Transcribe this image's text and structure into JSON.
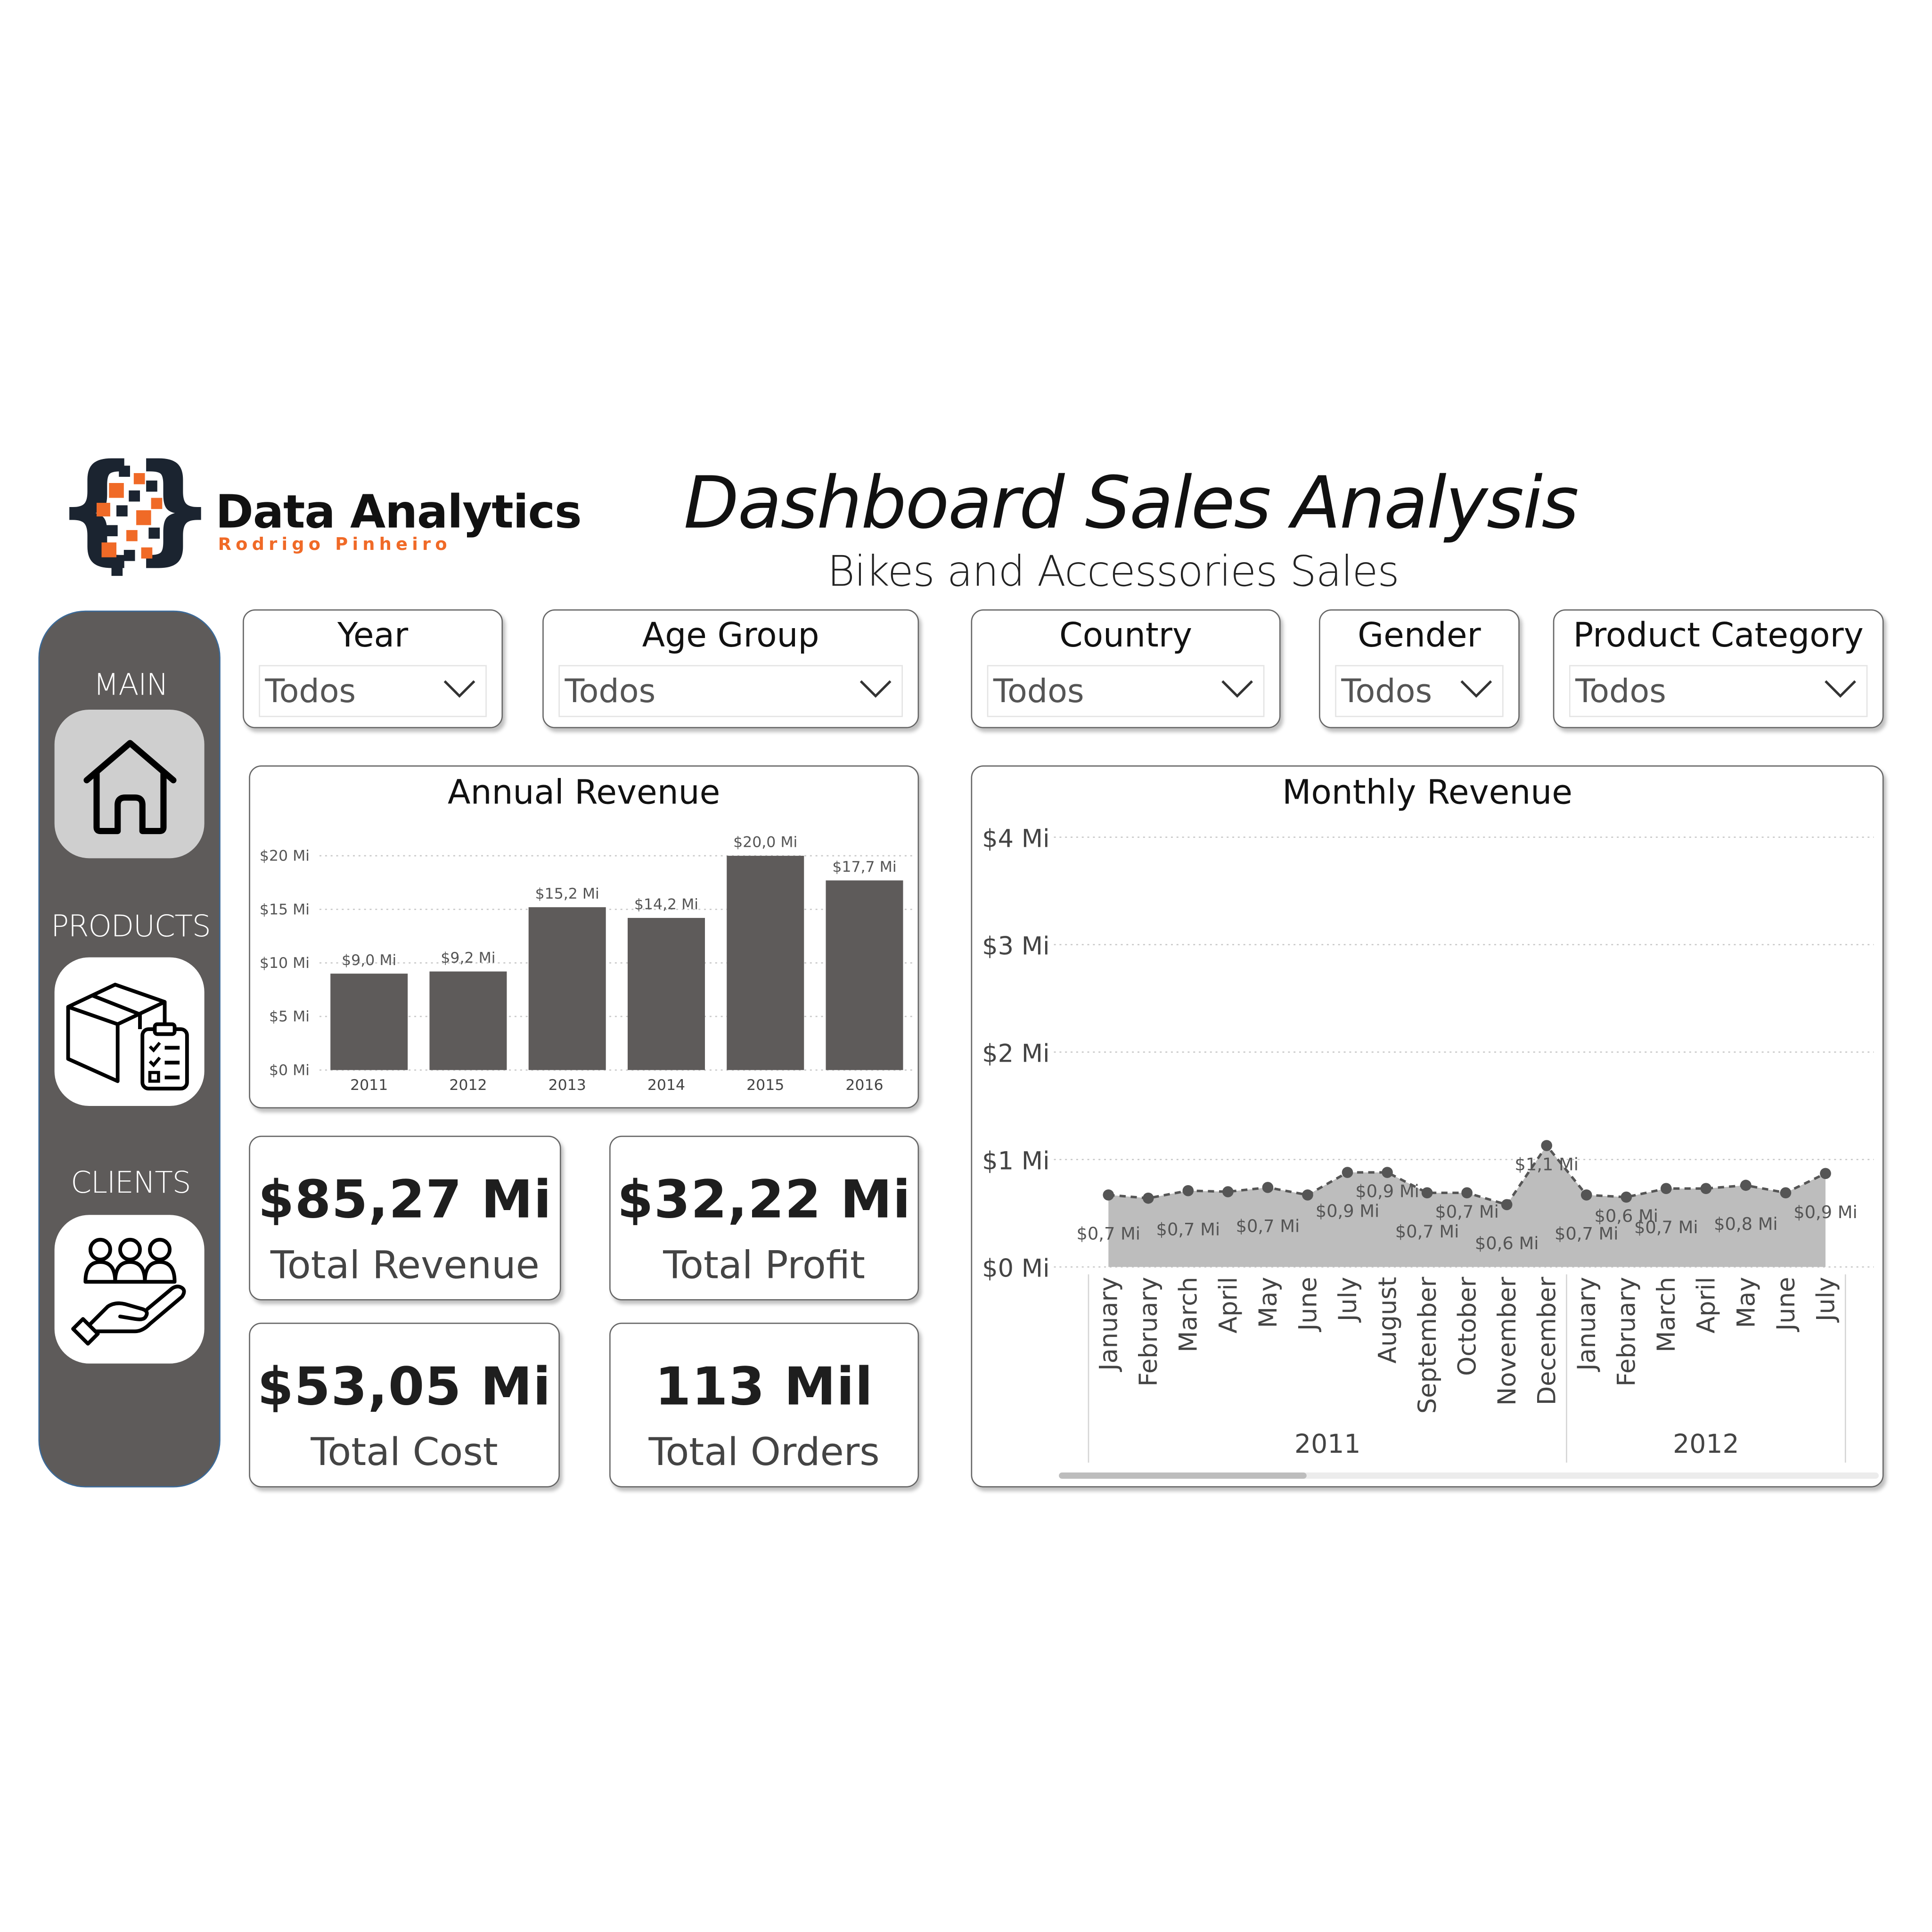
{
  "brand": {
    "name": "Data Analytics",
    "author": "Rodrigo Pinheiro",
    "accent_color": "#f06a27",
    "dark_color": "#1b2430"
  },
  "header": {
    "title": "Dashboard Sales Analysis",
    "subtitle": "Bikes and Accessories Sales"
  },
  "sidebar": {
    "items": [
      {
        "label": "MAIN",
        "icon": "home-icon",
        "active": true
      },
      {
        "label": "PRODUCTS",
        "icon": "package-checklist-icon",
        "active": false
      },
      {
        "label": "CLIENTS",
        "icon": "clients-hand-icon",
        "active": false
      }
    ],
    "background": "#5e5b5a"
  },
  "slicers": [
    {
      "title": "Year",
      "value": "Todos"
    },
    {
      "title": "Age Group",
      "value": "Todos"
    },
    {
      "title": "Country",
      "value": "Todos"
    },
    {
      "title": "Gender",
      "value": "Todos"
    },
    {
      "title": "Product Category",
      "value": "Todos"
    }
  ],
  "kpis": [
    {
      "value": "$85,27 Mi",
      "label": "Total Revenue"
    },
    {
      "value": "$32,22 Mi",
      "label": "Total Profit"
    },
    {
      "value": "$53,05 Mi",
      "label": "Total Cost"
    },
    {
      "value": "113 Mil",
      "label": "Total Orders"
    }
  ],
  "chart_data": [
    {
      "type": "bar",
      "title": "Annual Revenue",
      "categories": [
        "2011",
        "2012",
        "2013",
        "2014",
        "2015",
        "2016"
      ],
      "values": [
        9.0,
        9.2,
        15.2,
        14.2,
        20.0,
        17.7
      ],
      "value_labels": [
        "$9,0 Mi",
        "$9,2 Mi",
        "$15,2 Mi",
        "$14,2 Mi",
        "$20,0 Mi",
        "$17,7 Mi"
      ],
      "yticks": [
        0,
        5,
        10,
        15,
        20
      ],
      "ytick_labels": [
        "$0 Mi",
        "$5 Mi",
        "$10 Mi",
        "$15 Mi",
        "$20 Mi"
      ],
      "ylim": [
        0,
        20
      ],
      "bar_color": "#5e5b5a",
      "grid": true
    },
    {
      "type": "area",
      "title": "Monthly Revenue",
      "x": [
        "January",
        "February",
        "March",
        "April",
        "May",
        "June",
        "July",
        "August",
        "September",
        "October",
        "November",
        "December",
        "January",
        "February",
        "March",
        "April",
        "May",
        "June",
        "July"
      ],
      "years": [
        {
          "label": "2011",
          "months": 12
        },
        {
          "label": "2012",
          "months": 7
        }
      ],
      "values": [
        0.67,
        0.64,
        0.71,
        0.7,
        0.74,
        0.67,
        0.88,
        0.88,
        0.69,
        0.69,
        0.58,
        1.13,
        0.67,
        0.65,
        0.73,
        0.73,
        0.76,
        0.69,
        0.87
      ],
      "value_labels": [
        "$0,7 Mi",
        "",
        "$0,7 Mi",
        "",
        "$0,7 Mi",
        "",
        "$0,9 Mi",
        "$0,9 Mi",
        "$0,7 Mi",
        "$0,7 Mi",
        "$0,6 Mi",
        "$1,1 Mi",
        "$0,7 Mi",
        "$0,6 Mi",
        "$0,7 Mi",
        "",
        "$0,8 Mi",
        "",
        "$0,9 Mi"
      ],
      "yticks": [
        0,
        1,
        2,
        3,
        4
      ],
      "ytick_labels": [
        "$0 Mi",
        "$1 Mi",
        "$2 Mi",
        "$3 Mi",
        "$4 Mi"
      ],
      "ylim": [
        0,
        4
      ],
      "fill_color": "#bdbdbd",
      "line_color": "#555555",
      "grid": true
    }
  ]
}
